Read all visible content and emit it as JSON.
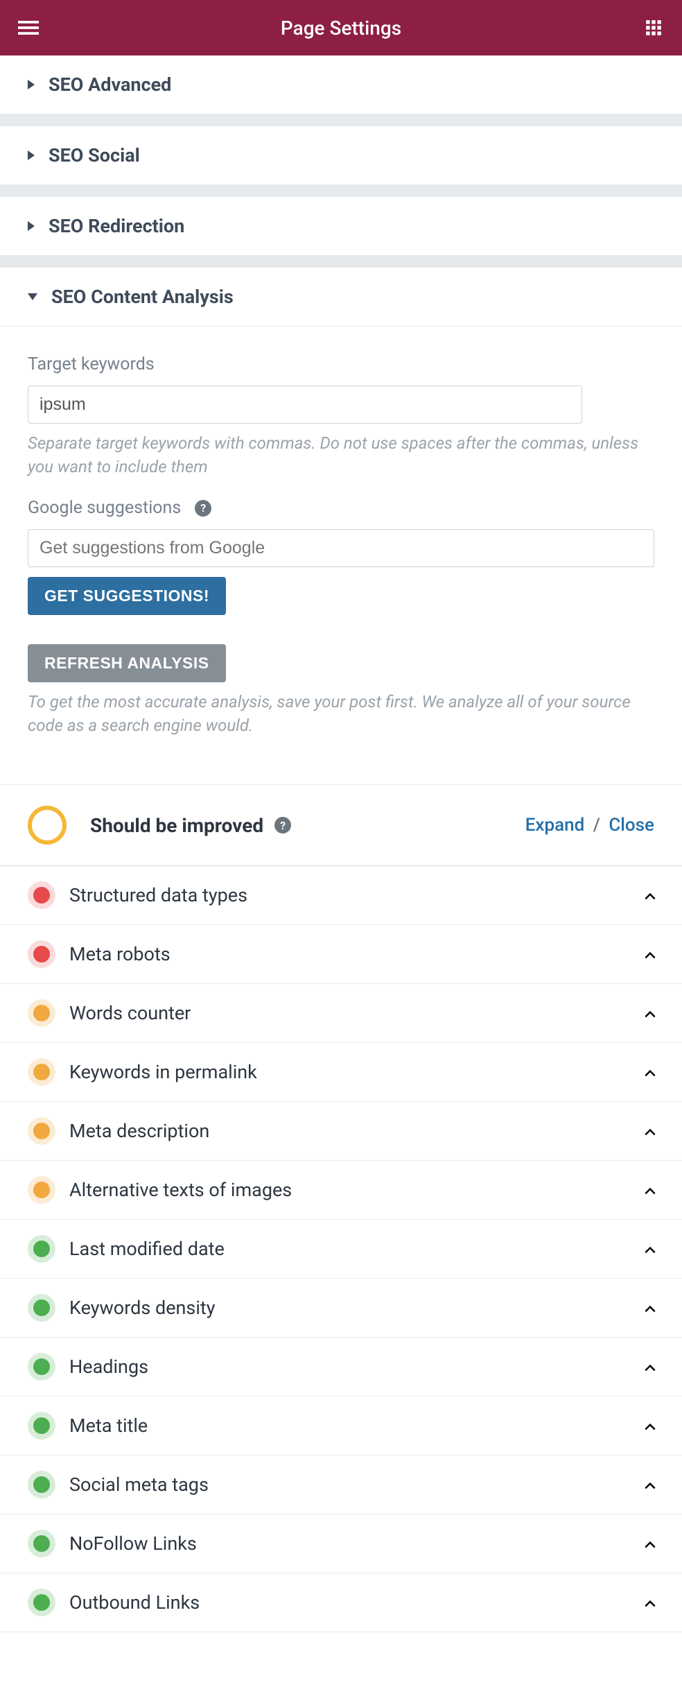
{
  "header": {
    "title": "Page Settings"
  },
  "accordions": [
    {
      "title": "SEO Advanced",
      "expanded": false
    },
    {
      "title": "SEO Social",
      "expanded": false
    },
    {
      "title": "SEO Redirection",
      "expanded": false
    },
    {
      "title": "SEO Content Analysis",
      "expanded": true
    }
  ],
  "targetKeywords": {
    "label": "Target keywords",
    "value": "ipsum",
    "help": "Separate target keywords with commas. Do not use spaces after the commas, unless you want to include them"
  },
  "googleSuggestions": {
    "label": "Google suggestions",
    "placeholder": "Get suggestions from Google",
    "button": "GET SUGGESTIONS!"
  },
  "refresh": {
    "button": "REFRESH ANALYSIS",
    "help": "To get the most accurate analysis, save your post first. We analyze all of your source code as a search engine would."
  },
  "score": {
    "title": "Should be improved",
    "expand": "Expand",
    "close": "Close"
  },
  "metrics": [
    {
      "label": "Structured data types",
      "status": "red"
    },
    {
      "label": "Meta robots",
      "status": "red"
    },
    {
      "label": "Words counter",
      "status": "orange"
    },
    {
      "label": "Keywords in permalink",
      "status": "orange"
    },
    {
      "label": "Meta description",
      "status": "orange"
    },
    {
      "label": "Alternative texts of images",
      "status": "orange"
    },
    {
      "label": "Last modified date",
      "status": "green"
    },
    {
      "label": "Keywords density",
      "status": "green"
    },
    {
      "label": "Headings",
      "status": "green"
    },
    {
      "label": "Meta title",
      "status": "green"
    },
    {
      "label": "Social meta tags",
      "status": "green"
    },
    {
      "label": "NoFollow Links",
      "status": "green"
    },
    {
      "label": "Outbound Links",
      "status": "green"
    }
  ]
}
